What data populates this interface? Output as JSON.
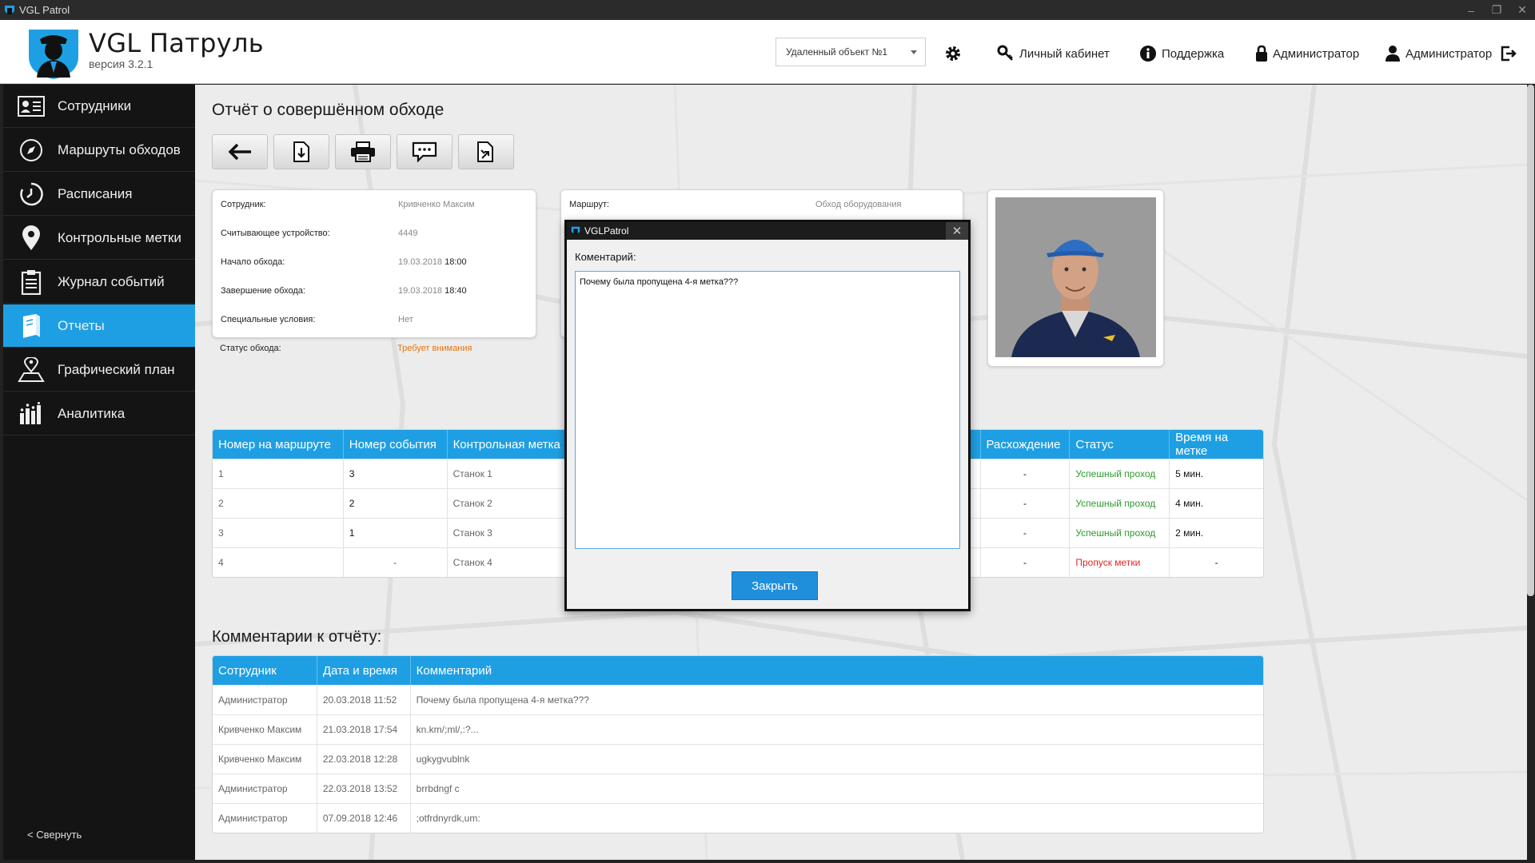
{
  "window": {
    "title": "VGL Patrol",
    "controls": [
      "–",
      "❐",
      "✕"
    ]
  },
  "header": {
    "app_name": "VGL Патруль",
    "version": "версия 3.2.1",
    "object_select": "Удаленный объект №1",
    "personal_cabinet": "Личный кабинет",
    "support": "Поддержка",
    "admin_lock": "Администратор",
    "admin_user": "Администратор",
    "icons": [
      "gear-icon",
      "key-icon",
      "info-icon",
      "lock-icon",
      "user-icon",
      "logout-icon"
    ]
  },
  "sidebar": {
    "items": [
      {
        "label": "Сотрудники",
        "icon": "employees-icon"
      },
      {
        "label": "Маршруты обходов",
        "icon": "compass-icon"
      },
      {
        "label": "Расписания",
        "icon": "clock-icon"
      },
      {
        "label": "Контрольные метки",
        "icon": "map-pin-icon"
      },
      {
        "label": "Журнал событий",
        "icon": "clipboard-icon"
      },
      {
        "label": "Отчеты",
        "icon": "reports-icon"
      },
      {
        "label": "Графический план",
        "icon": "map-plan-icon"
      },
      {
        "label": "Аналитика",
        "icon": "bar-chart-icon"
      }
    ],
    "active_index": 5,
    "collapse": "< Свернуть"
  },
  "page": {
    "title": "Отчёт о совершённом обходе",
    "toolbar": [
      "back-arrow-icon",
      "download-icon",
      "printer-icon",
      "comment-icon",
      "export-file-icon"
    ]
  },
  "info_card": {
    "rows": [
      {
        "label": "Сотрудник:",
        "value": "Кривченко Максим"
      },
      {
        "label": "Считывающее устройство:",
        "value": "4449"
      },
      {
        "label": "Начало обхода:",
        "date": "19.03.2018",
        "time": "18:00"
      },
      {
        "label": "Завершение обхода:",
        "date": "19.03.2018",
        "time": "18:40"
      },
      {
        "label": "Специальные условия:",
        "value": "Нет"
      },
      {
        "label": "Статус обхода:",
        "value": "Требует внимания"
      }
    ]
  },
  "route_card": {
    "label": "Маршрут:",
    "value": "Обход оборудования"
  },
  "checkpoints_table": {
    "headers": [
      "Номер на маршруте",
      "Номер события",
      "Контрольная метка",
      "Расхождение",
      "Статус",
      "Время на метке"
    ],
    "rows": [
      {
        "num": "1",
        "event": "3",
        "mark": "Станок 1",
        "diff": "-",
        "status": "Успешный проход",
        "time": "5 мин."
      },
      {
        "num": "2",
        "event": "2",
        "mark": "Станок 2",
        "diff": "-",
        "status": "Успешный проход",
        "time": "4 мин."
      },
      {
        "num": "3",
        "event": "1",
        "mark": "Станок 3",
        "diff": "-",
        "status": "Успешный проход",
        "time": "2 мин."
      },
      {
        "num": "4",
        "event": "-",
        "mark": "Станок 4",
        "diff": "-",
        "status": "Пропуск метки",
        "time": "-"
      }
    ]
  },
  "comments": {
    "title": "Комментарии к отчёту:",
    "headers": [
      "Сотрудник",
      "Дата и время",
      "Комментарий"
    ],
    "rows": [
      {
        "author": "Администратор",
        "datetime": "20.03.2018 11:52",
        "text": "Почему была пропущена 4-я метка???"
      },
      {
        "author": "Кривченко Максим",
        "datetime": "21.03.2018 17:54",
        "text": "kn.km/;ml/,:?..."
      },
      {
        "author": "Кривченко Максим",
        "datetime": "22.03.2018 12:28",
        "text": "ugkygvublnk"
      },
      {
        "author": "Администратор",
        "datetime": "22.03.2018 13:52",
        "text": "brrbdngf c"
      },
      {
        "author": "Администратор",
        "datetime": "07.09.2018 12:46",
        "text": ";otfrdnyrdk,um:"
      }
    ]
  },
  "modal": {
    "title": "VGLPatrol",
    "close_glyph": "✕",
    "label": "Коментарий:",
    "text": "Почему была пропущена 4-я метка???",
    "button": "Закрыть"
  },
  "colors": {
    "accent": "#1f9fe3",
    "ok": "#2c9a2c",
    "error": "#e0261f",
    "warning": "#e8740c",
    "sidebar": "#141414"
  }
}
